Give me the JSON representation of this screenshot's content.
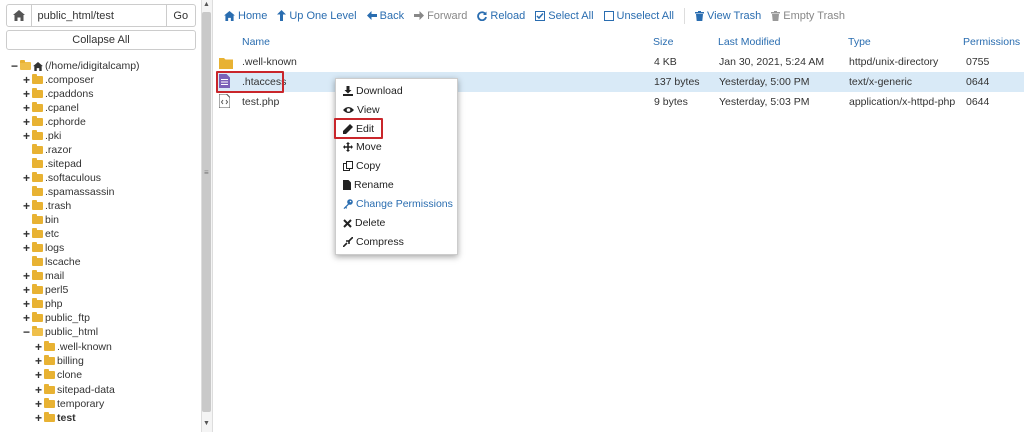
{
  "path_bar": {
    "value": "public_html/test",
    "go_label": "Go",
    "collapse_label": "Collapse All"
  },
  "tree": {
    "root": "(/home/idigitalcamp)",
    "items": [
      ".composer",
      ".cpaddons",
      ".cpanel",
      ".cphorde",
      ".pki",
      ".razor",
      ".sitepad",
      ".softaculous",
      ".spamassassin",
      ".trash",
      "bin",
      "etc",
      "logs",
      "lscache",
      "mail",
      "perl5",
      "php",
      "public_ftp",
      "public_html"
    ],
    "public_html_children": [
      ".well-known",
      "billing",
      "clone",
      "sitepad-data",
      "temporary",
      "test"
    ]
  },
  "toolbar": {
    "home": "Home",
    "up": "Up One Level",
    "back": "Back",
    "forward": "Forward",
    "reload": "Reload",
    "select_all": "Select All",
    "unselect_all": "Unselect All",
    "view_trash": "View Trash",
    "empty_trash": "Empty Trash"
  },
  "table": {
    "headers": {
      "name": "Name",
      "size": "Size",
      "modified": "Last Modified",
      "type": "Type",
      "perms": "Permissions"
    },
    "rows": [
      {
        "name": ".well-known",
        "size": "4 KB",
        "modified": "Jan 30, 2021, 5:24 AM",
        "type": "httpd/unix-directory",
        "perms": "0755",
        "icon": "folder-icon"
      },
      {
        "name": ".htaccess",
        "size": "137 bytes",
        "modified": "Yesterday, 5:00 PM",
        "type": "text/x-generic",
        "perms": "0644",
        "icon": "text-file-icon"
      },
      {
        "name": "test.php",
        "size": "9 bytes",
        "modified": "Yesterday, 5:03 PM",
        "type": "application/x-httpd-php",
        "perms": "0644",
        "icon": "php-file-icon"
      }
    ]
  },
  "context_menu": {
    "items": [
      "Download",
      "View",
      "Edit",
      "Move",
      "Copy",
      "Rename",
      "Change Permissions",
      "Delete",
      "Compress"
    ]
  },
  "colors": {
    "link_blue": "#2a6db0",
    "folder_yellow": "#e8b233",
    "selected_row": "#d9eaf7",
    "highlight_red": "#c9262b"
  }
}
